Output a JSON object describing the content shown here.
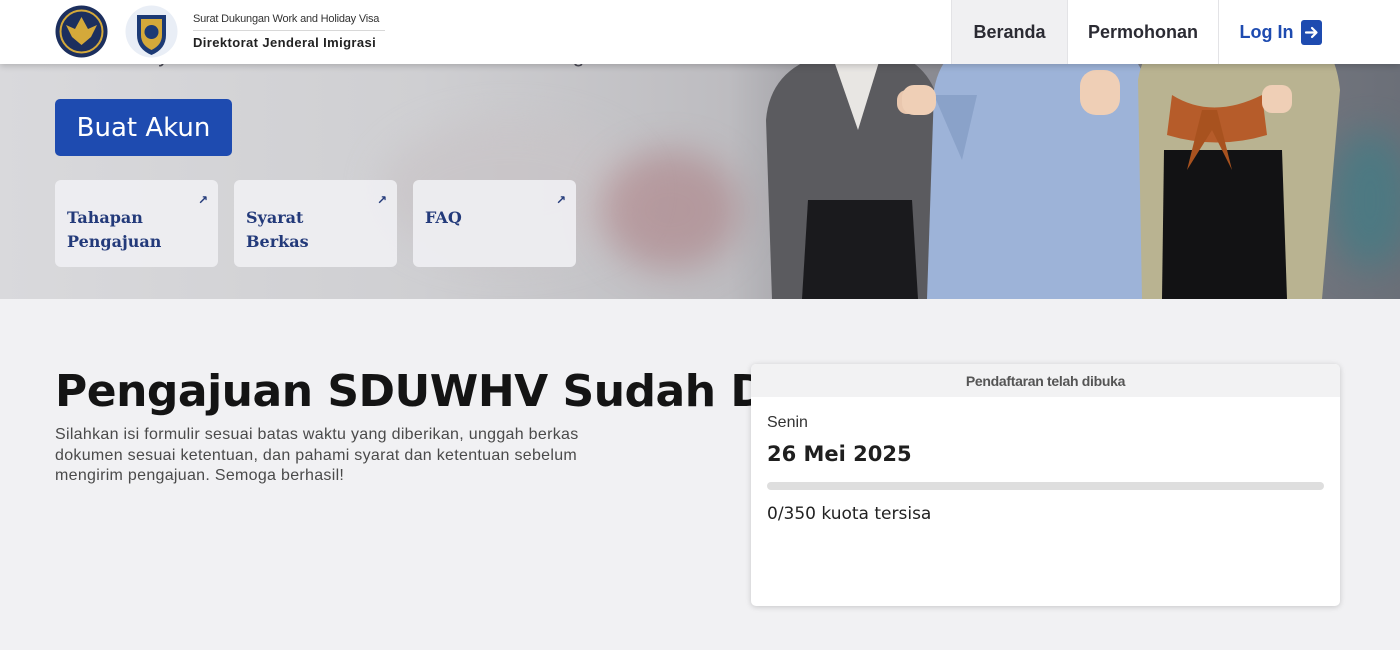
{
  "navbar": {
    "brand_subtitle": "Surat Dukungan Work and Holiday Visa",
    "brand_title": "Direktorat Jenderal Imigrasi",
    "items": [
      {
        "label": "Beranda"
      },
      {
        "label": "Permohonan"
      },
      {
        "label": "Log In"
      }
    ],
    "login_icon": "login-arrow-icon"
  },
  "hero": {
    "partial_text": "and Holiday Visa Australia dan Direktorat Jenderal Imigrasi.",
    "cta_label": "Buat Akun",
    "cards": [
      {
        "label": "Tahapan Pengajuan",
        "icon": "external-link-icon"
      },
      {
        "label": "Syarat Berkas",
        "icon": "external-link-icon"
      },
      {
        "label": "FAQ",
        "icon": "external-link-icon"
      }
    ]
  },
  "main": {
    "headline": "Pengajuan SDUWHV Sudah Dibuka!",
    "description": "Silahkan isi formulir sesuai batas waktu yang diberikan, unggah berkas dokumen sesuai ketentuan, dan pahami syarat dan ketentuan sebelum mengirim pengajuan. Semoga berhasil!"
  },
  "status_card": {
    "header": "Pendaftaran telah dibuka",
    "day": "Senin",
    "date": "26 Mei 2025",
    "quota_text": "0/350 kuota tersisa",
    "quota_remaining_fraction": 0
  },
  "colors": {
    "primary": "#1e4bb0",
    "card_text": "#233a7a"
  }
}
